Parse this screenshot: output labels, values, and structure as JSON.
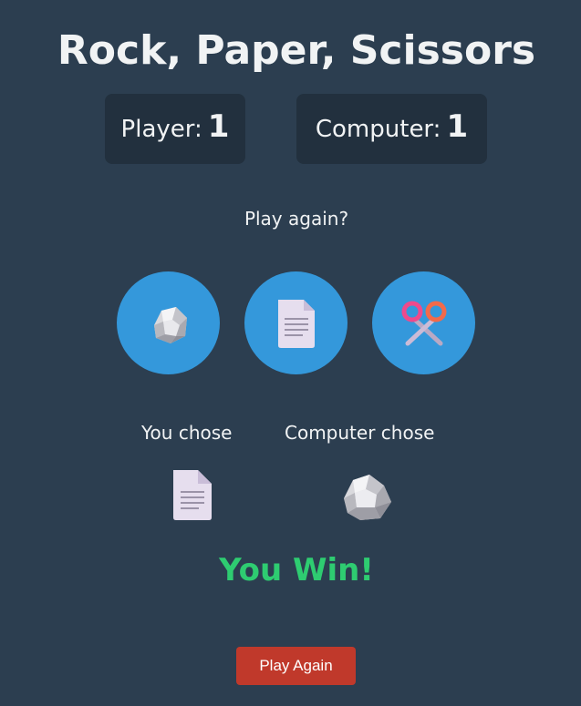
{
  "game": {
    "title": "Rock, Paper, Scissors",
    "player_label": "Player:",
    "player_score": "1",
    "computer_label": "Computer:",
    "computer_score": "1",
    "prompt": "Play again?",
    "choices": [
      {
        "id": "rock",
        "icon": "rock-icon"
      },
      {
        "id": "paper",
        "icon": "paper-icon"
      },
      {
        "id": "scissors",
        "icon": "scissors-icon"
      }
    ],
    "you_chose_label": "You chose",
    "computer_chose_label": "Computer chose",
    "you_chose": "paper",
    "computer_chose": "rock",
    "result": "You Win!",
    "play_again_label": "Play Again"
  },
  "colors": {
    "background": "#2c3e50",
    "score_box": "#22303e",
    "choice_button": "#3498db",
    "result_win": "#2ecc71",
    "play_again_button": "#c0392b"
  }
}
